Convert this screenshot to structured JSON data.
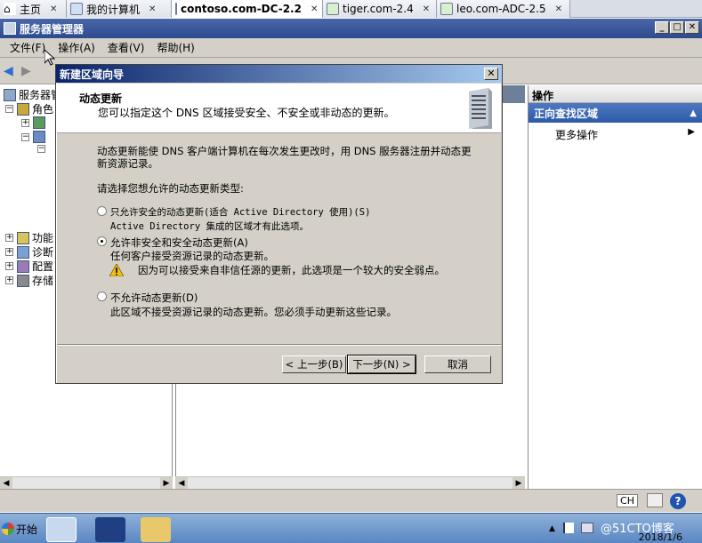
{
  "vm_tabs": [
    {
      "label": "主页"
    },
    {
      "label": "我的计算机"
    },
    {
      "label": "contoso.com-DC-2.2"
    },
    {
      "label": "tiger.com-2.4"
    },
    {
      "label": "leo.com-ADC-2.5"
    }
  ],
  "window": {
    "title": "服务器管理器"
  },
  "menu": [
    "文件(F)",
    "操作(A)",
    "查看(V)",
    "帮助(H)"
  ],
  "tree": {
    "root": "服务器管理",
    "roles": "角色",
    "features": "功能",
    "diagnostics": "诊断",
    "config": "配置",
    "storage": "存储"
  },
  "actions_pane": {
    "header": "操作",
    "section": "正向查找区域",
    "more": "更多操作"
  },
  "dialog": {
    "title": "新建区域向导",
    "heading": "动态更新",
    "subheading": "您可以指定这个 DNS 区域接受安全、不安全或非动态的更新。",
    "description_line1": "动态更新能使 DNS 客户端计算机在每次发生更改时，用 DNS 服务器注册并动态更",
    "description_line2": "新资源记录。",
    "prompt": "请选择您想允许的动态更新类型:",
    "options": [
      {
        "label": "只允许安全的动态更新(适合 Active Directory 使用)(S)",
        "detail": "Active Directory 集成的区域才有此选项。",
        "checked": false
      },
      {
        "label": "允许非安全和安全动态更新(A)",
        "detail": "任何客户接受资源记录的动态更新。",
        "warning": "因为可以接受来自非信任源的更新，此选项是一个较大的安全弱点。",
        "checked": true
      },
      {
        "label": "不允许动态更新(D)",
        "detail": "此区域不接受资源记录的动态更新。您必须手动更新这些记录。",
        "checked": false
      }
    ],
    "buttons": {
      "back": "< 上一步(B)",
      "next": "下一步(N) >",
      "cancel": "取消"
    }
  },
  "statusbar": {
    "lang": "CH"
  },
  "taskbar": {
    "start": "开始",
    "date": "2018/1/6",
    "watermark": "@51CTO博客"
  }
}
